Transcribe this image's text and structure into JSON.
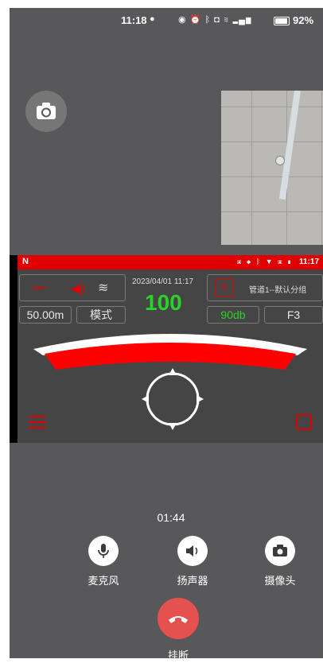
{
  "status_bar": {
    "time": "11:18",
    "battery_percent": "92%",
    "battery_level": 0.92
  },
  "shared_screen": {
    "app_status_time": "11:17",
    "datetime": "2023/04/01 11:17",
    "big_value": "100",
    "range": "50.00m",
    "mode": "模式",
    "db": "90db",
    "freq": "F3",
    "pipeline_label": "管道1--默认分组"
  },
  "call": {
    "duration": "01:44",
    "mic_label": "麦克风",
    "speaker_label": "扬声器",
    "camera_label": "摄像头",
    "hangup_label": "挂断"
  },
  "colors": {
    "accent_red": "#e00000",
    "value_green": "#2bd12b",
    "hangup_red": "#e4514e",
    "background": "#58585a"
  },
  "icons": [
    "chat-bubble-icon",
    "eye-icon",
    "alarm-icon",
    "bluetooth-icon",
    "camera-icon",
    "wifi-icon",
    "signal-icon",
    "battery-icon",
    "camera-switch-icon",
    "microphone-icon",
    "speaker-icon",
    "camera-icon",
    "hangup-phone-icon"
  ]
}
